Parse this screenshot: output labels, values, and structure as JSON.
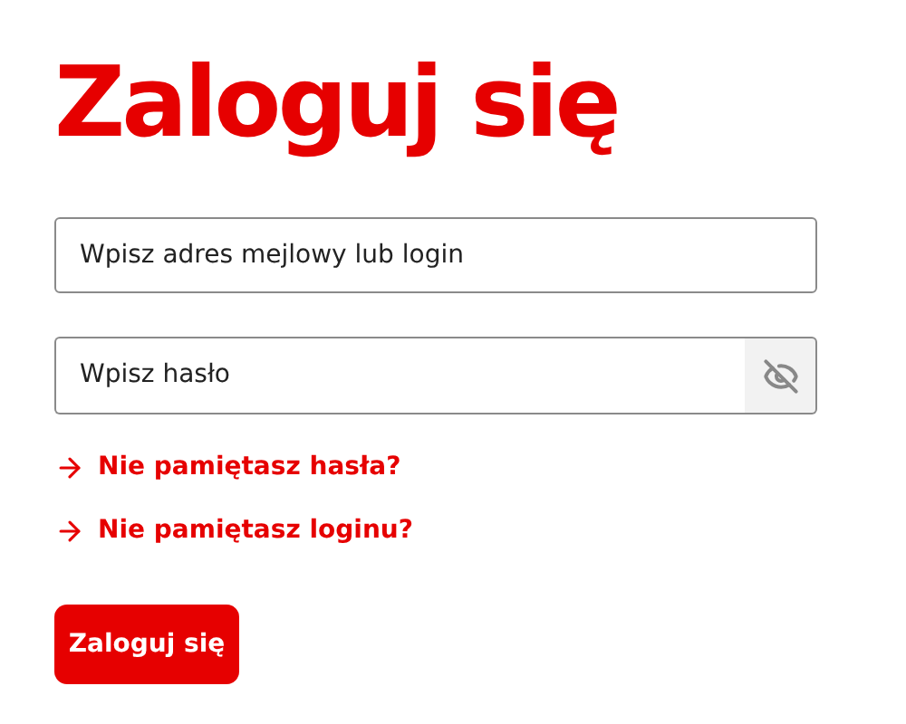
{
  "title": "Zaloguj się",
  "login_field": {
    "placeholder": "Wpisz adres mejlowy lub login"
  },
  "password_field": {
    "placeholder": "Wpisz hasło"
  },
  "links": [
    {
      "label": "Nie pamiętasz hasła?"
    },
    {
      "label": "Nie pamiętasz loginu?"
    }
  ],
  "submit_button": "Zaloguj się"
}
